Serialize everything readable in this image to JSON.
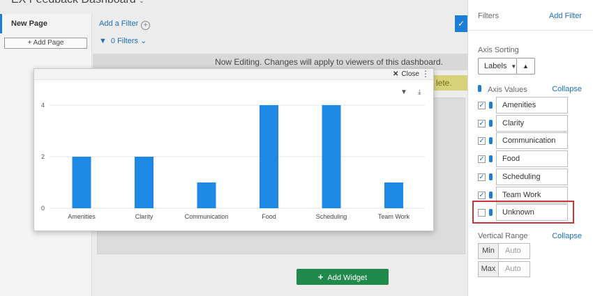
{
  "header": {
    "title": "EX Feedback Dashboard"
  },
  "nav": {
    "page_label": "New Page",
    "add_page_label": "Add Page"
  },
  "dashboard": {
    "add_filter_label": "Add a Filter",
    "filter_count_label": "0 Filters",
    "editing_notice": "Now Editing. Changes will apply to viewers of this dashboard.",
    "yellow_notice": "lete.",
    "add_widget_label": "Add Widget"
  },
  "modal": {
    "close_label": "Close"
  },
  "chart_data": {
    "type": "bar",
    "categories": [
      "Amenities",
      "Clarity",
      "Communication",
      "Food",
      "Scheduling",
      "Team Work"
    ],
    "values": [
      2,
      2,
      1,
      4,
      4,
      1
    ],
    "yticks": [
      "0",
      "2",
      "4"
    ],
    "ylim": [
      0,
      4
    ],
    "grid": true,
    "bar_color": "#1e88e5"
  },
  "panel": {
    "title": "Filters",
    "add_filter_label": "Add Filter",
    "axis_sorting_label": "Axis Sorting",
    "sort_value": "Labels",
    "axis_values_label": "Axis Values",
    "collapse_label": "Collapse",
    "axis_values": [
      {
        "label": "Amenities",
        "checked": true
      },
      {
        "label": "Clarity",
        "checked": true
      },
      {
        "label": "Communication",
        "checked": true
      },
      {
        "label": "Food",
        "checked": true
      },
      {
        "label": "Scheduling",
        "checked": true
      },
      {
        "label": "Team Work",
        "checked": true
      },
      {
        "label": "Unknown",
        "checked": false
      }
    ],
    "vertical_range_label": "Vertical Range",
    "vertical_collapse_label": "Collapse",
    "min_label": "Min",
    "max_label": "Max",
    "min_placeholder": "Auto",
    "max_placeholder": "Auto"
  },
  "colors": {
    "accent": "#1c7ed6",
    "highlight": "#c9343a",
    "add_widget": "#1f8a4c"
  }
}
